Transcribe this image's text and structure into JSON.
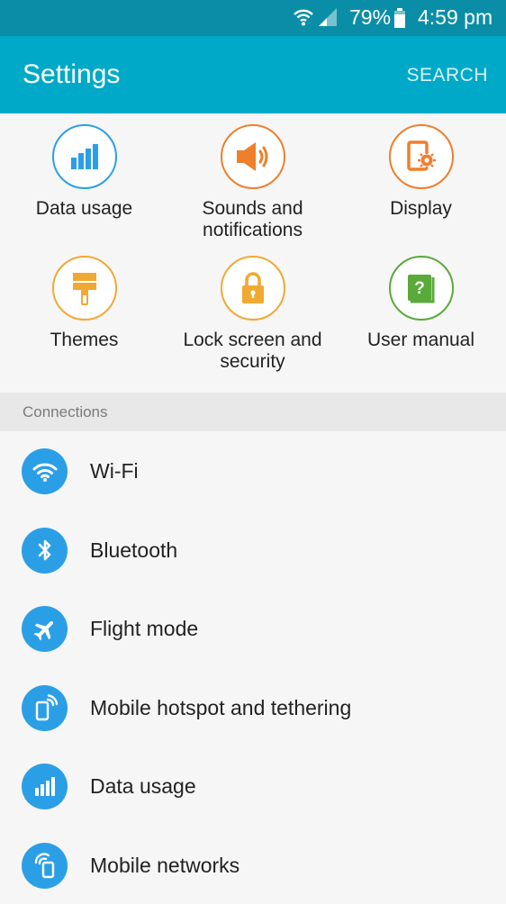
{
  "status_bar": {
    "battery_percent": "79%",
    "time": "4:59 pm"
  },
  "app_bar": {
    "title": "Settings",
    "search_label": "SEARCH"
  },
  "quick_settings": [
    {
      "label": "Data usage",
      "icon": "bar-chart-icon",
      "color": "#2b9fe6"
    },
    {
      "label": "Sounds and notifications",
      "icon": "speaker-icon",
      "color": "#ef7f2c"
    },
    {
      "label": "Display",
      "icon": "display-gear-icon",
      "color": "#ef7f2c"
    },
    {
      "label": "Themes",
      "icon": "paintbrush-icon",
      "color": "#f0a933"
    },
    {
      "label": "Lock screen and security",
      "icon": "padlock-icon",
      "color": "#f0a933"
    },
    {
      "label": "User manual",
      "icon": "help-book-icon",
      "color": "#5aaa3a"
    }
  ],
  "sections": {
    "connections": {
      "header": "Connections",
      "items": [
        {
          "label": "Wi-Fi",
          "icon": "wifi-icon"
        },
        {
          "label": "Bluetooth",
          "icon": "bluetooth-icon"
        },
        {
          "label": "Flight mode",
          "icon": "airplane-icon"
        },
        {
          "label": "Mobile hotspot and tethering",
          "icon": "hotspot-icon"
        },
        {
          "label": "Data usage",
          "icon": "bar-chart-icon"
        },
        {
          "label": "Mobile networks",
          "icon": "mobile-networks-icon"
        }
      ]
    }
  },
  "colors": {
    "status_bar": "#0a8ea8",
    "app_bar": "#00a9c8",
    "list_icon_bg": "#2b9fe6"
  }
}
